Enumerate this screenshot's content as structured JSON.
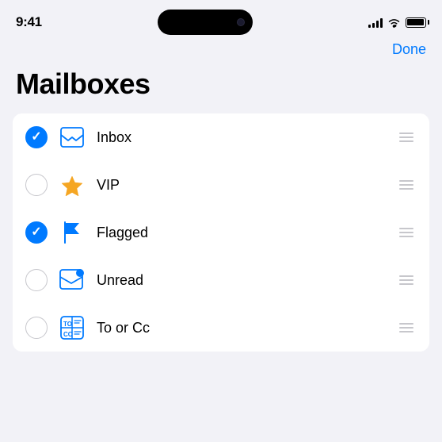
{
  "status_bar": {
    "time": "9:41",
    "signal_bars": [
      4,
      6,
      9,
      12,
      14
    ],
    "battery_level": 100
  },
  "nav": {
    "done_label": "Done"
  },
  "page": {
    "title": "Mailboxes"
  },
  "items": [
    {
      "id": "inbox",
      "label": "Inbox",
      "checked": true,
      "icon": "inbox"
    },
    {
      "id": "vip",
      "label": "VIP",
      "checked": false,
      "icon": "star"
    },
    {
      "id": "flagged",
      "label": "Flagged",
      "checked": true,
      "icon": "flag"
    },
    {
      "id": "unread",
      "label": "Unread",
      "checked": false,
      "icon": "unread"
    },
    {
      "id": "to-or-cc",
      "label": "To or Cc",
      "checked": false,
      "icon": "tocc"
    }
  ]
}
